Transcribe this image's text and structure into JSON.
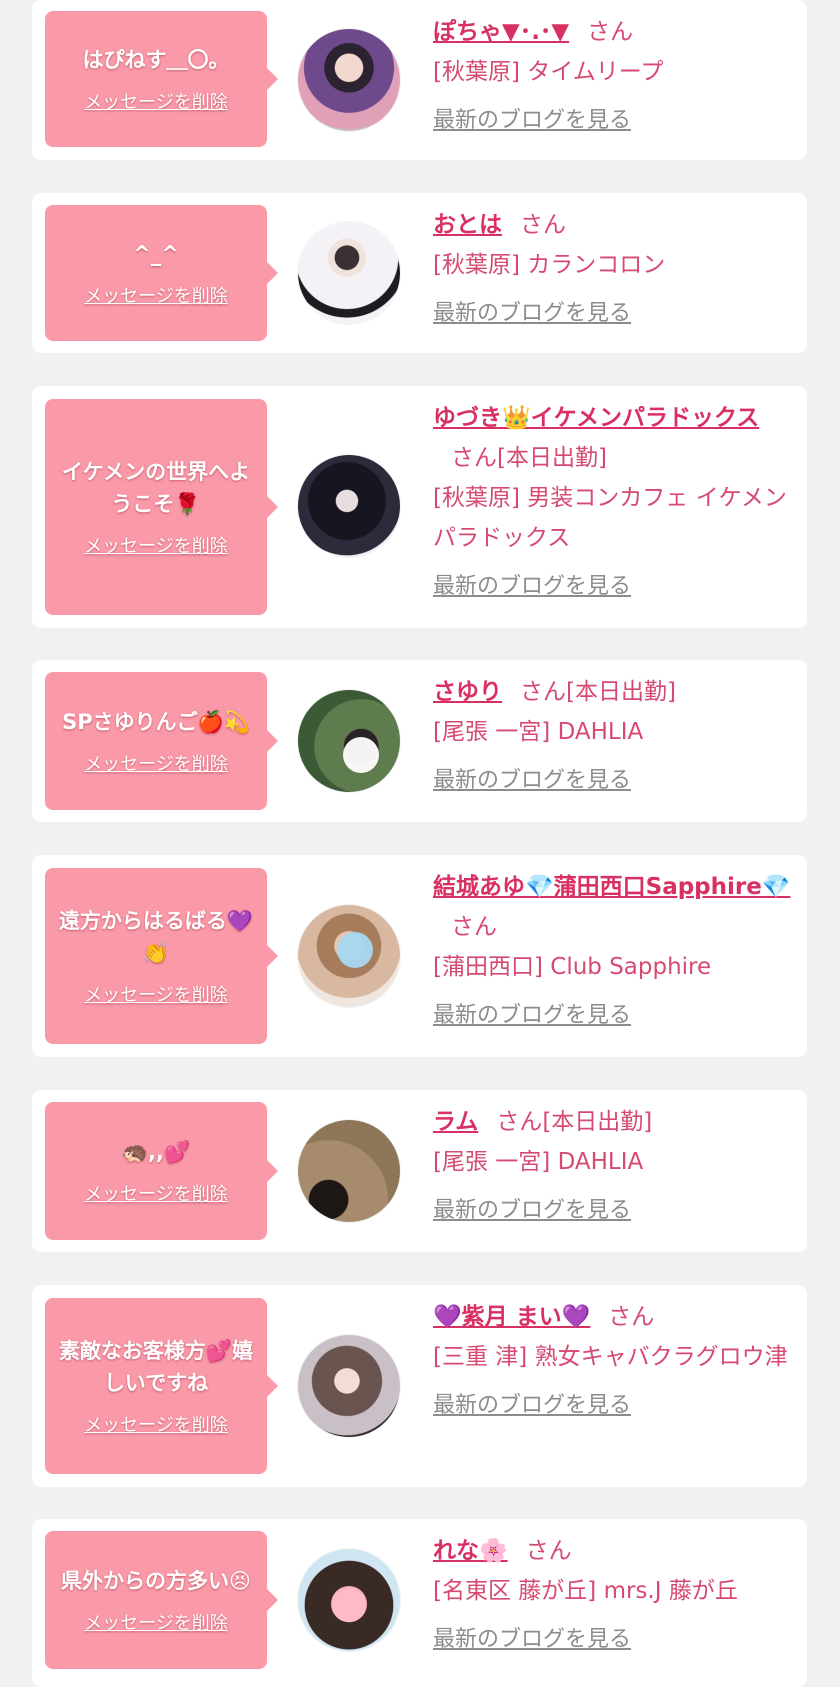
{
  "colors": {
    "bubble": "#fa9aa8",
    "name": "#d93063",
    "text": "#d64a72",
    "blog_link": "#8c8c8c",
    "card": "#ffffff",
    "page_bg": "#f1f1f1"
  },
  "delete_label": "メッセージを削除",
  "blog_label": "最新のブログを見る",
  "items": [
    {
      "message": "はぴねす＿〇。",
      "name": "ぽちゃ▼･.･▼",
      "honorific": "さん",
      "shop": "[秋葉原] タイムリープ",
      "avatar_icon": "profile-photo"
    },
    {
      "message": "^_^",
      "name": "おとは",
      "honorific": "さん",
      "shop": "[秋葉原] カランコロン",
      "avatar_icon": "profile-photo"
    },
    {
      "message": "イケメンの世界へようこそ🌹",
      "name": "ゆづき👑イケメンパラドックス",
      "honorific": "さん[本日出勤]",
      "shop": "[秋葉原] 男装コンカフェ イケメンパラドックス",
      "avatar_icon": "profile-photo"
    },
    {
      "message": "SPさゆりんご🍎💫",
      "name": "さゆり",
      "honorific": "さん[本日出勤]",
      "shop": "[尾張 一宮] DAHLIA",
      "avatar_icon": "profile-photo"
    },
    {
      "message": "遠方からはるばる💜👏",
      "name": "結城あゆ💎蒲田西口Sapphire💎",
      "honorific": "さん",
      "shop": "[蒲田西口] Club Sapphire",
      "avatar_icon": "profile-photo"
    },
    {
      "message": "🦔,,💕",
      "name": "ラム",
      "honorific": "さん[本日出勤]",
      "shop": "[尾張 一宮] DAHLIA",
      "avatar_icon": "profile-photo"
    },
    {
      "message": "素敵なお客様方💕嬉しいですね",
      "name": "💜紫月 まい💜",
      "honorific": "さん",
      "shop": "[三重 津] 熟女キャバクラグロウ津",
      "avatar_icon": "profile-photo"
    },
    {
      "message": "県外からの方多い😣",
      "name": "れな🌸",
      "honorific": "さん",
      "shop": "[名東区 藤が丘] mrs.J 藤が丘",
      "avatar_icon": "profile-photo"
    }
  ]
}
